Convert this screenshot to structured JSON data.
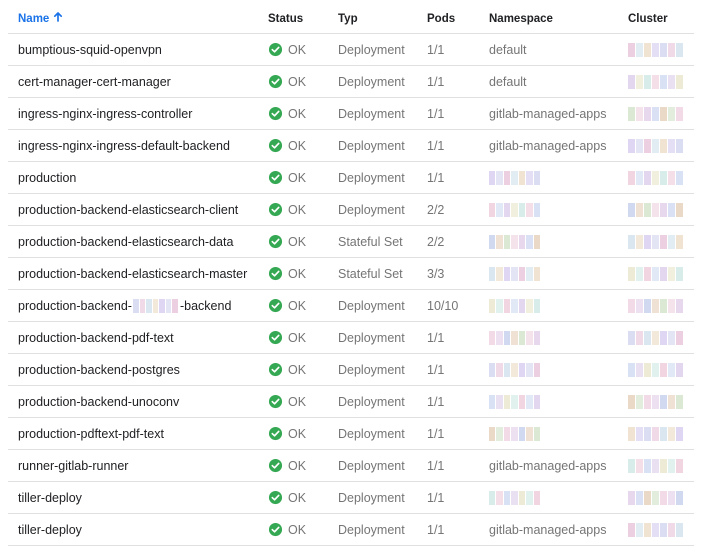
{
  "colors": {
    "accent": "#1a73e8",
    "ok_green": "#34a853",
    "muted_text": "#757575",
    "divider": "#e0e0e0"
  },
  "headers": {
    "name": "Name",
    "status": "Status",
    "type": "Typ",
    "pods": "Pods",
    "namespace": "Namespace",
    "cluster": "Cluster"
  },
  "sort": {
    "column": "name",
    "direction": "ascending",
    "icon": "arrow-up-icon"
  },
  "status_icon": "check-circle-icon",
  "rows": [
    {
      "name": "bumptious-squid-openvpn",
      "status": "OK",
      "type": "Deployment",
      "pods": "1/1",
      "namespace": "default"
    },
    {
      "name": "cert-manager-cert-manager",
      "status": "OK",
      "type": "Deployment",
      "pods": "1/1",
      "namespace": "default"
    },
    {
      "name": "ingress-nginx-ingress-controller",
      "status": "OK",
      "type": "Deployment",
      "pods": "1/1",
      "namespace": "gitlab-managed-apps"
    },
    {
      "name": "ingress-nginx-ingress-default-backend",
      "status": "OK",
      "type": "Deployment",
      "pods": "1/1",
      "namespace": "gitlab-managed-apps"
    },
    {
      "name": "production",
      "status": "OK",
      "type": "Deployment",
      "pods": "1/1",
      "namespace": ""
    },
    {
      "name": "production-backend-elasticsearch-client",
      "status": "OK",
      "type": "Deployment",
      "pods": "2/2",
      "namespace": ""
    },
    {
      "name": "production-backend-elasticsearch-data",
      "status": "OK",
      "type": "Stateful Set",
      "pods": "2/2",
      "namespace": ""
    },
    {
      "name": "production-backend-elasticsearch-master",
      "status": "OK",
      "type": "Stateful Set",
      "pods": "3/3",
      "namespace": ""
    },
    {
      "name_prefix": "production-backend-",
      "name_suffix": "-backend",
      "status": "OK",
      "type": "Deployment",
      "pods": "10/10",
      "namespace": ""
    },
    {
      "name": "production-backend-pdf-text",
      "status": "OK",
      "type": "Deployment",
      "pods": "1/1",
      "namespace": ""
    },
    {
      "name": "production-backend-postgres",
      "status": "OK",
      "type": "Deployment",
      "pods": "1/1",
      "namespace": ""
    },
    {
      "name": "production-backend-unoconv",
      "status": "OK",
      "type": "Deployment",
      "pods": "1/1",
      "namespace": ""
    },
    {
      "name": "production-pdftext-pdf-text",
      "status": "OK",
      "type": "Deployment",
      "pods": "1/1",
      "namespace": ""
    },
    {
      "name": "runner-gitlab-runner",
      "status": "OK",
      "type": "Deployment",
      "pods": "1/1",
      "namespace": "gitlab-managed-apps"
    },
    {
      "name": "tiller-deploy",
      "status": "OK",
      "type": "Deployment",
      "pods": "1/1",
      "namespace": ""
    },
    {
      "name": "tiller-deploy",
      "status": "OK",
      "type": "Deployment",
      "pods": "1/1",
      "namespace": "gitlab-managed-apps"
    }
  ]
}
